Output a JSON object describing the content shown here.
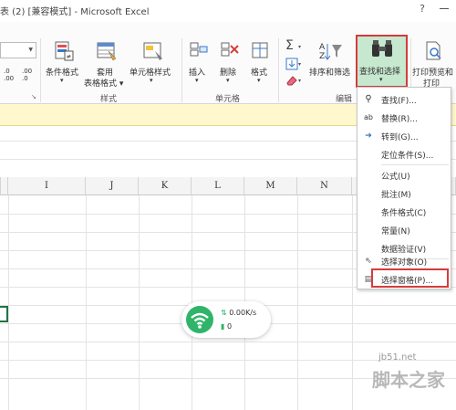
{
  "window": {
    "title": "表 (2)  [兼容模式] - Microsoft Excel",
    "help": "?"
  },
  "ribbon": {
    "number_format_btns": [
      ".0 .00",
      ".00 .0"
    ],
    "styles_group": {
      "label": "样式",
      "buttons": [
        {
          "label": "条件格式",
          "sub": "▾"
        },
        {
          "label": "套用",
          "sub": "表格格式 ▾"
        },
        {
          "label": "单元格样式",
          "sub": "▾"
        }
      ]
    },
    "cells_group": {
      "label": "单元格",
      "buttons": [
        {
          "label": "插入",
          "sub": "▾"
        },
        {
          "label": "删除",
          "sub": "▾"
        },
        {
          "label": "格式",
          "sub": "▾"
        }
      ]
    },
    "editing_group": {
      "label": "编辑",
      "sort_filter": {
        "label": "排序和筛选"
      },
      "find_select": {
        "label": "查找和选择",
        "sub": "▾"
      }
    },
    "print_group": {
      "label_line1": "打印预览和",
      "label_line2": "打印"
    },
    "dialog_launcher": "↘"
  },
  "columns": [
    "I",
    "J",
    "K",
    "L",
    "M",
    "N"
  ],
  "find_select_menu": {
    "items": [
      {
        "label": "查找(F)...",
        "icon": "binoculars-icon",
        "glyph": "⛯"
      },
      {
        "label": "替换(R)...",
        "icon": "replace-icon",
        "glyph": "ab"
      },
      {
        "label": "转到(G)...",
        "icon": "arrow-right-icon",
        "glyph": "➔"
      },
      {
        "label": "定位条件(S)...",
        "icon": "none",
        "glyph": ""
      },
      {
        "label": "公式(U)",
        "icon": "none",
        "glyph": ""
      },
      {
        "label": "批注(M)",
        "icon": "none",
        "glyph": ""
      },
      {
        "label": "条件格式(C)",
        "icon": "none",
        "glyph": ""
      },
      {
        "label": "常量(N)",
        "icon": "none",
        "glyph": ""
      },
      {
        "label": "数据验证(V)",
        "icon": "none",
        "glyph": ""
      },
      {
        "label": "选择对象(O)",
        "icon": "cursor-icon",
        "glyph": "⇖"
      },
      {
        "label": "选择窗格(P)...",
        "icon": "selection-pane-icon",
        "glyph": "▤"
      }
    ]
  },
  "network_widget": {
    "speed": "0.00K/s",
    "connections": "0"
  },
  "watermark": {
    "url": "jb51.net",
    "name": "脚本之家"
  },
  "colors": {
    "accent_green": "#2fb46a",
    "selected_button_bg": "#c6e8cf",
    "highlight_red": "#d63b3b",
    "info_bar": "#fff8cc"
  }
}
